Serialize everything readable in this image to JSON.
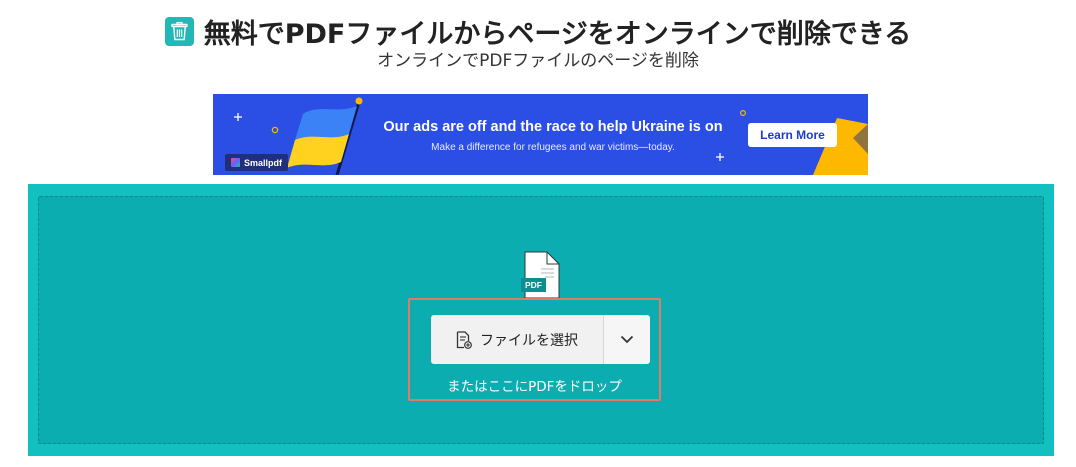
{
  "header": {
    "title": "無料でPDFファイルからページをオンラインで削除できる",
    "subtitle": "オンラインでPDFファイルのページを削除"
  },
  "banner": {
    "headline": "Our ads are off and the race to help Ukraine is on",
    "subtext": "Make a difference for refugees and war victims—today.",
    "cta_label": "Learn More",
    "logo_text": "Smallpdf",
    "colors": {
      "background": "#2b4ee5",
      "flag_blue": "#3b82f6",
      "flag_yellow": "#ffd21f",
      "accent_yellow": "#ffb800"
    }
  },
  "dropzone": {
    "file_icon_label": "PDF",
    "choose_file_label": "ファイルを選択",
    "drop_hint": "またはここにPDFをドロップ",
    "colors": {
      "outer": "#13c0c0",
      "inner": "#0cadb0",
      "highlight": "#e07b68"
    }
  },
  "icons": {
    "tool": "trash-icon",
    "file": "pdf-file-icon",
    "choose": "add-file-icon",
    "dropdown": "chevron-down-icon"
  }
}
